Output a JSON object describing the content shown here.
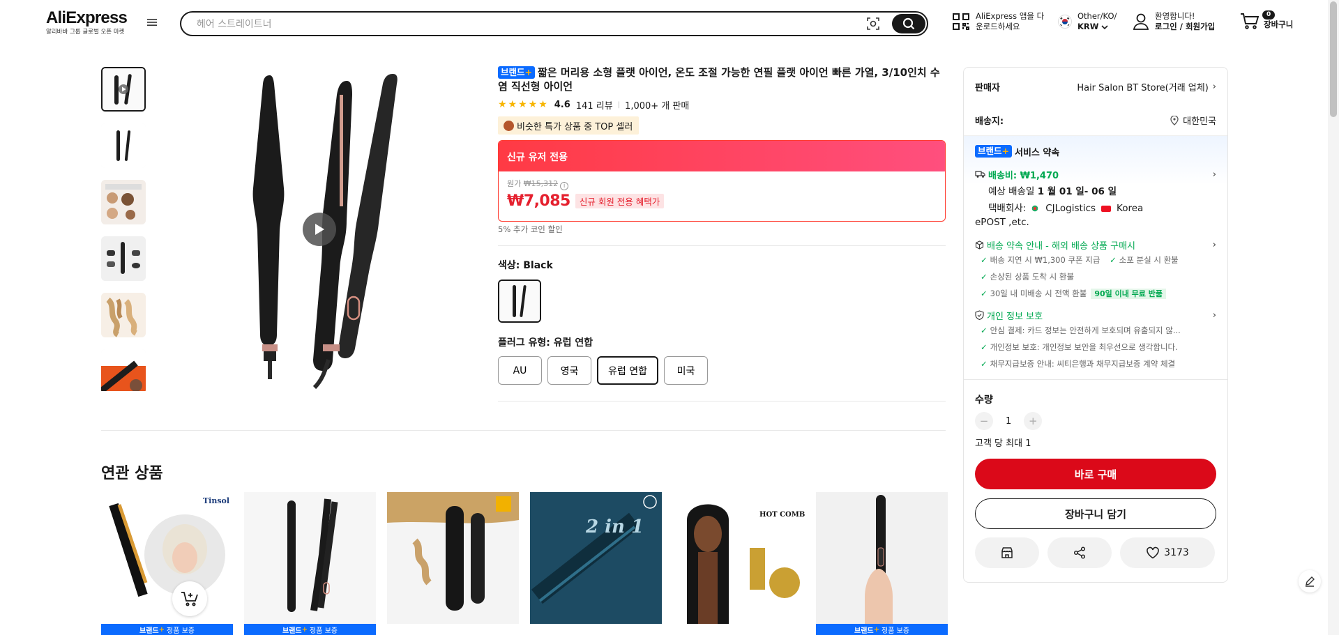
{
  "header": {
    "logo_text": "AliExpress",
    "logo_sub": "알리바바 그룹 글로벌 오픈 마켓",
    "search": {
      "placeholder": "헤어 스트레이트너"
    },
    "app_download_line1": "AliExpress 앱을 다",
    "app_download_line2": "운로드하세요",
    "lang_line1": "Other/KO/",
    "lang_line2": "KRW",
    "account_line1": "환영합니다!",
    "account_line2": "로그인 / 회원가입",
    "cart_count": "0",
    "cart_label": "장바구니"
  },
  "product": {
    "brand_tag": "브랜드",
    "brand_plus": "+",
    "title": "짧은 머리용 소형 플랫 아이언, 온도 조절 가능한 연필 플랫 아이언 빠른 가열, 3/10인치 수염 직선형 아이언",
    "stars": "★★★★★",
    "rating": "4.6",
    "reviews": "141 리뷰",
    "sold": "1,000+ 개 판매",
    "top_seller": "비슷한 특가 상품 중 TOP 셀러",
    "promo_header": "신규 유저 전용",
    "original_label": "원가",
    "original_price": "₩15,312",
    "price": "₩7,085",
    "price_badge": "신규 회원 전용 혜택가",
    "coin_discount": "5% 추가 코인 할인",
    "color_label": "색상: Black",
    "plug_label": "플러그 유형: 유럽 연합",
    "plug_options": [
      "AU",
      "영국",
      "유럽 연합",
      "미국"
    ],
    "selected_plug": "유럽 연합"
  },
  "panel": {
    "seller_label": "판매자",
    "seller_name": "Hair Salon BT Store(거래 업체)",
    "ship_to_label": "배송지:",
    "ship_to": "대한민국",
    "service_tag": "브랜드",
    "service_title": "서비스 약속",
    "shipping_fee": "배송비: ₩1,470",
    "delivery_prefix": "예상 배송일 ",
    "delivery_date": "1 월 01 일- 06 일",
    "carrier_prefix": "택배회사:",
    "carrier_1": "CJLogistics",
    "carrier_2": "Korea",
    "carrier_3": "ePOST ,etc.",
    "delivery_promise_title": "배송 약속 안내 - 해외 배송 상품 구매시",
    "promise_1": "배송 지연 시 ₩1,300 쿠폰 지급",
    "promise_2": "소포 분실 시 환불",
    "promise_3": "손상된 상품 도착 시 환불",
    "promise_4": "30일 내 미배송 시 전액 환불",
    "promise_badge": "90일 이내 무료 반품",
    "privacy_title": "개인 정보 보호",
    "privacy_1": "안심 결제: 카드 정보는 안전하게 보호되며 유출되지 않...",
    "privacy_2": "개인정보 보호: 개인정보 보안을 최우선으로 생각합니다.",
    "privacy_3": "채무지급보증 안내: 씨티은행과 채무지급보증 계약 체결",
    "qty_label": "수량",
    "qty_value": "1",
    "qty_limit": "고객 당 최대 1",
    "buy_now": "바로 구매",
    "add_to_cart": "장바구니 담기",
    "wishlist_count": "3173"
  },
  "related": {
    "title": "연관 상품",
    "badge_brand": "브랜드",
    "badge_plus": "+",
    "badge_text": "정품 보증",
    "brand_tinsol": "Tinsol",
    "hot_comb": "HOT COMB",
    "two_in_one": "2 in 1"
  },
  "colors": {
    "accent_red": "#db0919",
    "brand_blue": "#0b6bff",
    "green": "#00a850"
  }
}
